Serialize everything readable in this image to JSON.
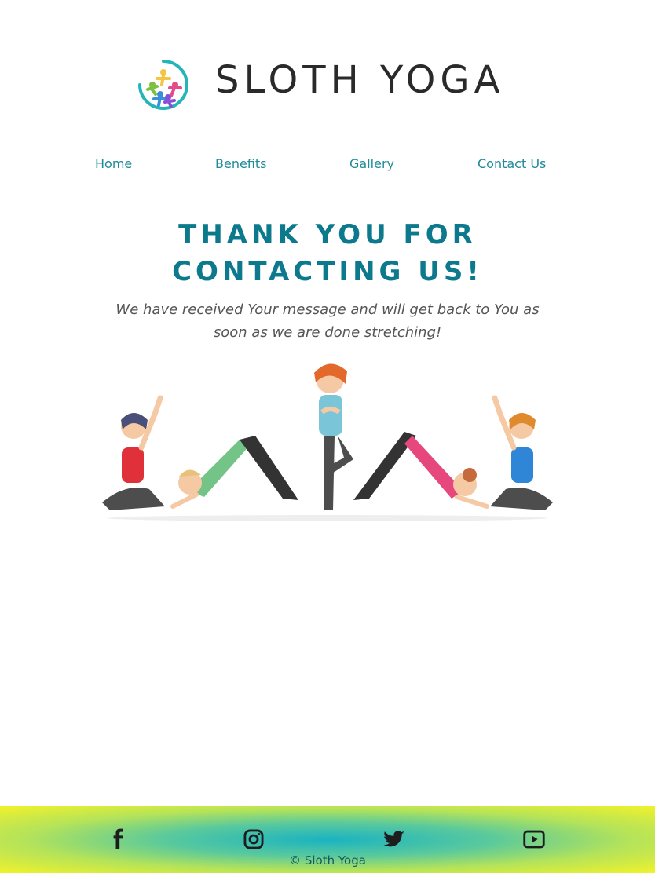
{
  "header": {
    "brand_name": "SLOTH YOGA"
  },
  "nav": {
    "items": [
      {
        "label": "Home"
      },
      {
        "label": "Benefits"
      },
      {
        "label": "Gallery"
      },
      {
        "label": "Contact Us"
      }
    ]
  },
  "main": {
    "title_line1": "THANK YOU FOR",
    "title_line2": "CONTACTING US!",
    "message": "We have received Your message and will get back to You as soon as we are done stretching!"
  },
  "footer": {
    "social": [
      {
        "icon": "facebook-icon"
      },
      {
        "icon": "instagram-icon"
      },
      {
        "icon": "twitter-icon"
      },
      {
        "icon": "youtube-icon"
      }
    ],
    "copyright": "© Sloth Yoga"
  },
  "colors": {
    "accent": "#0c7a8c",
    "nav_link": "#1f8a98",
    "footer_gradient": [
      "#1ab3c2",
      "#59c99d",
      "#b4e35a",
      "#f2f22a"
    ]
  }
}
